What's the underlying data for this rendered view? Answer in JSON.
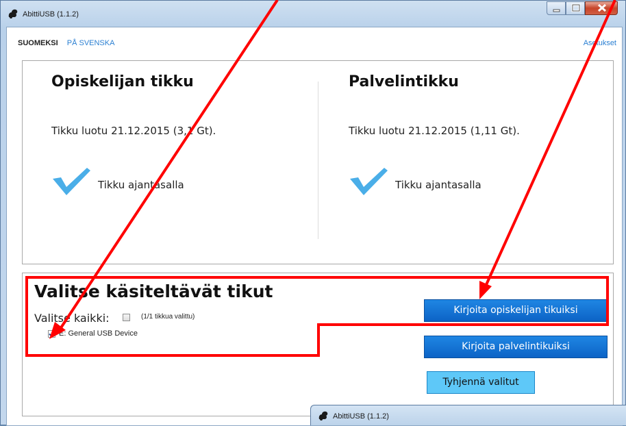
{
  "window": {
    "title": "AbittiUSB (1.1.2)"
  },
  "header": {
    "lang_fi": "SUOMEKSI",
    "lang_sv": "PÅ SVENSKA",
    "settings": "Asetukset"
  },
  "student_stick": {
    "title": "Opiskelijan tikku",
    "info": "Tikku luotu 21.12.2015 (3,1 Gt).",
    "status": "Tikku ajantasalla"
  },
  "server_stick": {
    "title": "Palvelintikku",
    "info": "Tikku luotu 21.12.2015 (1,11 Gt).",
    "status": "Tikku ajantasalla"
  },
  "selection": {
    "title": "Valitse käsiteltävät tikut",
    "select_all_label": "Valitse kaikki:",
    "select_all_checked": false,
    "count_text": "(1/1 tikkua valittu)",
    "devices": [
      {
        "label": "E:  General USB Device",
        "checked": true
      }
    ]
  },
  "actions": {
    "write_student": "Kirjoita opiskelijan tikuiksi",
    "write_server": "Kirjoita palvelintikuiksi",
    "clear": "Tyhjennä valitut"
  },
  "second_window": {
    "title": "AbittiUSB (1.1.2)"
  },
  "colors": {
    "accent_button": "#0c63c6",
    "clear_button": "#5ec8f8",
    "check_icon": "#4aaee8",
    "link": "#2a7fd2",
    "annotation": "#ff0000"
  }
}
